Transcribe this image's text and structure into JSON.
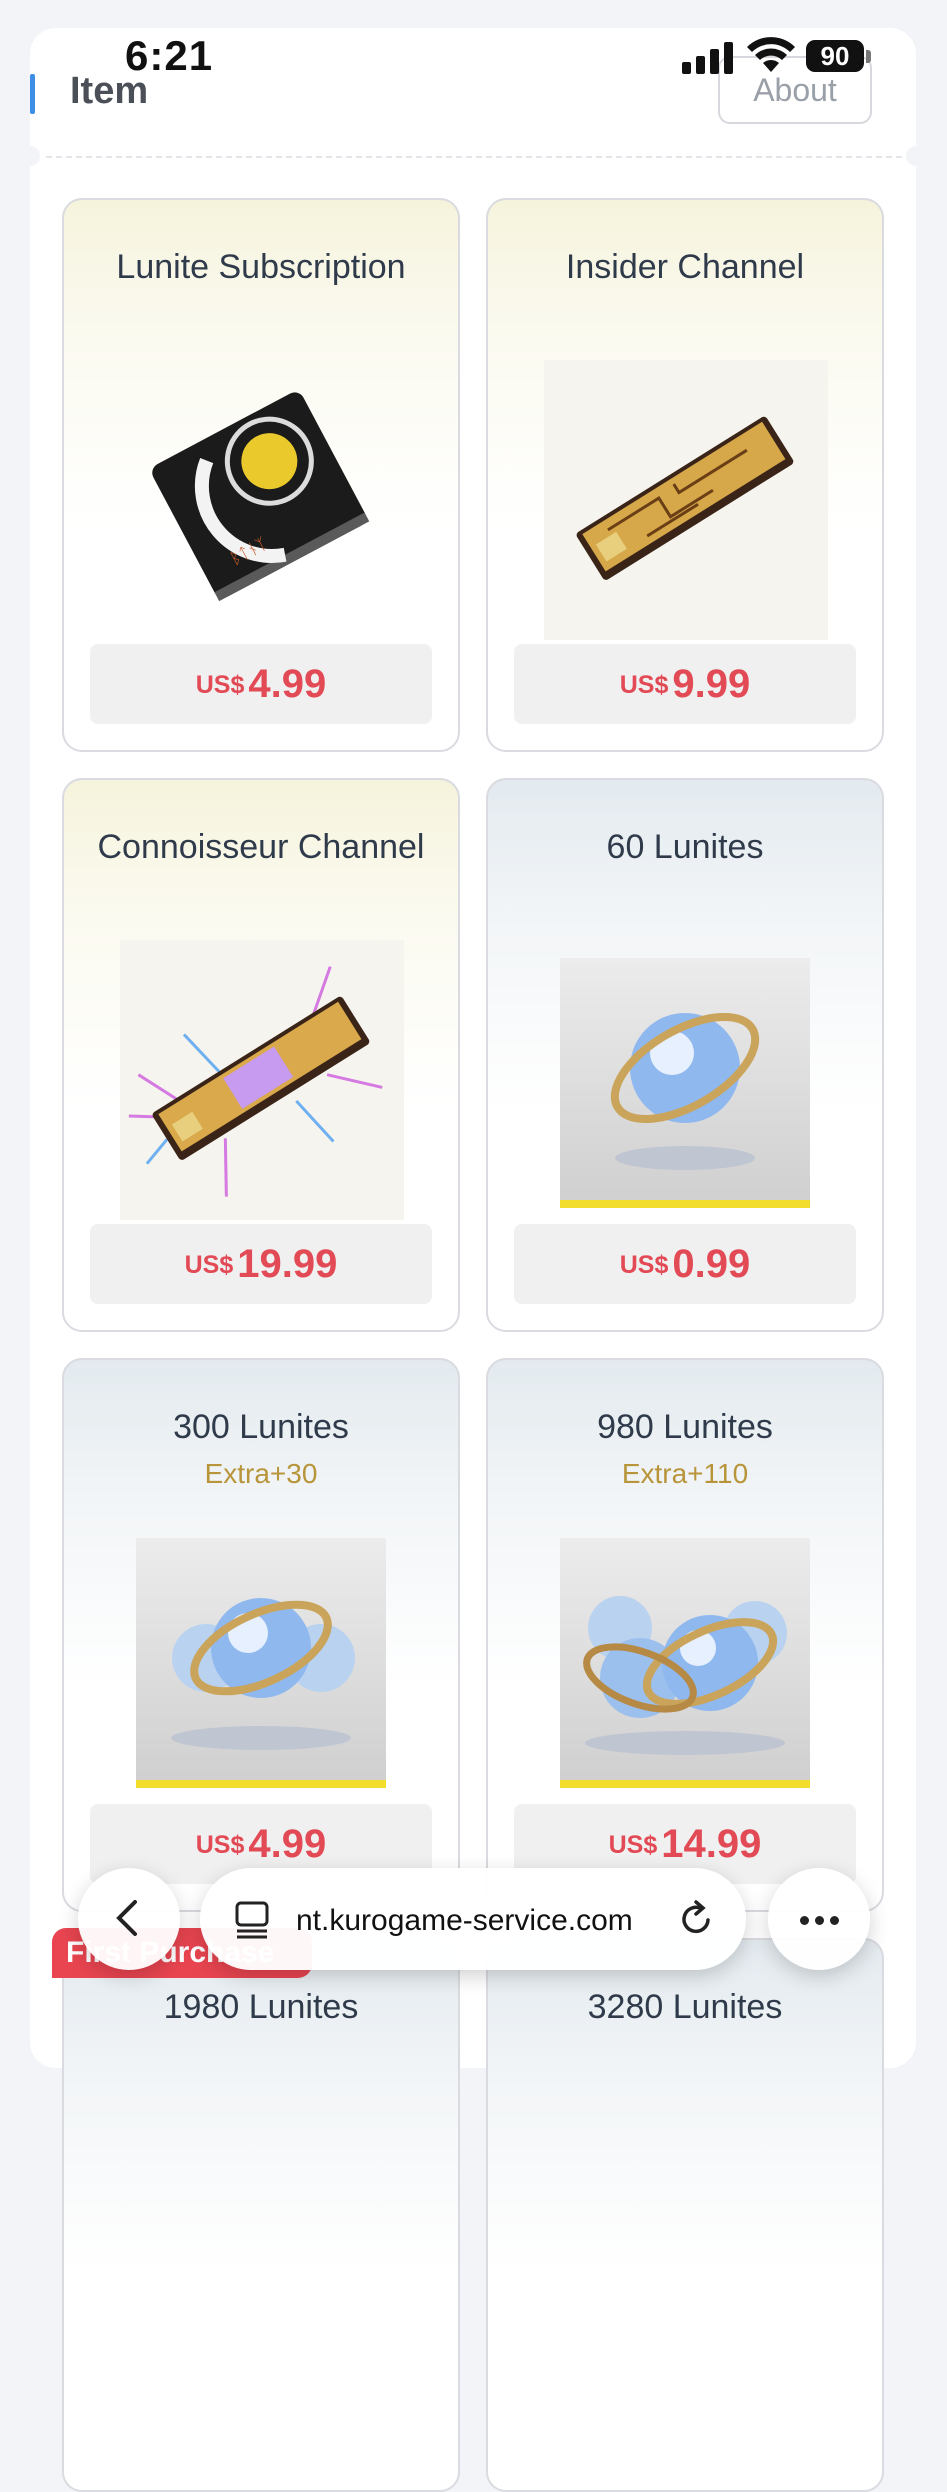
{
  "status": {
    "time": "6:21",
    "battery": "90"
  },
  "header": {
    "title": "Item",
    "about_label": "About"
  },
  "items": [
    {
      "title": "Lunite Subscription",
      "extra": "",
      "currency": "US$",
      "price": "4.99",
      "theme": "gold",
      "image": "lunite-subscription-card-icon"
    },
    {
      "title": "Insider Channel",
      "extra": "",
      "currency": "US$",
      "price": "9.99",
      "theme": "gold",
      "image": "insider-chip-icon"
    },
    {
      "title": "Connoisseur Channel",
      "extra": "",
      "currency": "US$",
      "price": "19.99",
      "theme": "gold",
      "image": "connoisseur-chip-icon"
    },
    {
      "title": "60 Lunites",
      "extra": "",
      "currency": "US$",
      "price": "0.99",
      "theme": "blue",
      "image": "lunite-orb-icon"
    },
    {
      "title": "300 Lunites",
      "extra": "Extra+30",
      "currency": "US$",
      "price": "4.99",
      "theme": "blue",
      "image": "lunite-orbs-icon"
    },
    {
      "title": "980 Lunites",
      "extra": "Extra+110",
      "currency": "US$",
      "price": "14.99",
      "theme": "blue",
      "image": "lunite-orb-pile-icon"
    },
    {
      "title": "1980 Lunites",
      "theme": "blue"
    },
    {
      "title": "3280 Lunites",
      "theme": "blue"
    }
  ],
  "badge": {
    "label": "First Purchase"
  },
  "browser": {
    "url": "nt.kurogame-service.com"
  },
  "colors": {
    "price": "#e24a55",
    "accent": "#3f8ee6",
    "extra": "#b8953a"
  }
}
